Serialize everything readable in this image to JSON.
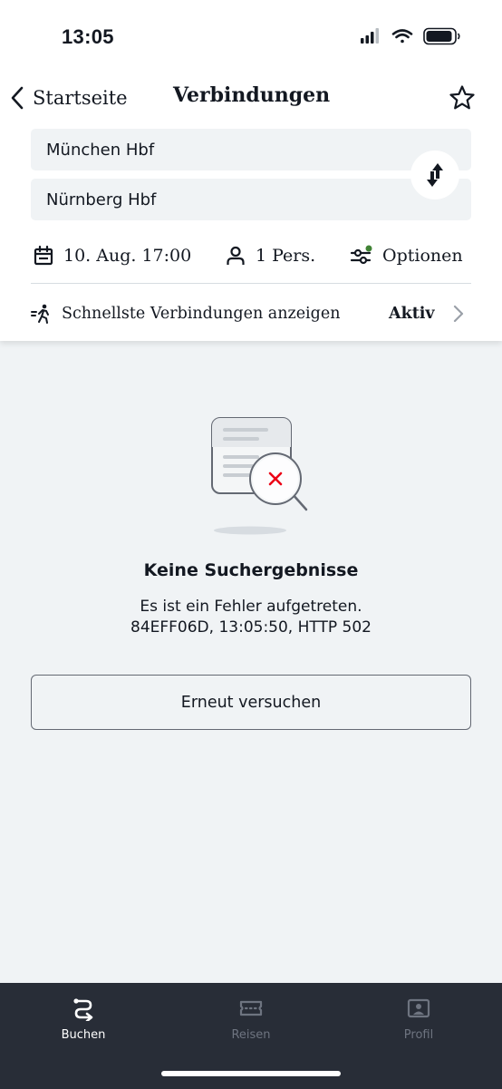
{
  "status_bar": {
    "time": "13:05"
  },
  "nav": {
    "back_label": "Startseite",
    "title": "Verbindungen"
  },
  "search": {
    "from": "München Hbf",
    "to": "Nürnberg Hbf"
  },
  "options": {
    "date": "10. Aug. 17:00",
    "persons": "1 Pers.",
    "options_label": "Optionen"
  },
  "fastest": {
    "label": "Schnellste Verbindungen anzeigen",
    "status": "Aktiv"
  },
  "empty_state": {
    "title": "Keine Suchergebnisse",
    "message_line1": "Es ist ein Fehler aufgetreten.",
    "message_line2": "84EFF06D, 13:05:50, HTTP 502",
    "retry_label": "Erneut versuchen"
  },
  "tabs": [
    {
      "label": "Buchen",
      "icon": "route-icon",
      "active": true
    },
    {
      "label": "Reisen",
      "icon": "ticket-icon",
      "active": false
    },
    {
      "label": "Profil",
      "icon": "profile-card-icon",
      "active": false
    }
  ],
  "colors": {
    "background": "#f0f3f5",
    "tab_bar": "#282d37",
    "error_red": "#ec0016",
    "options_dot": "#408335"
  }
}
